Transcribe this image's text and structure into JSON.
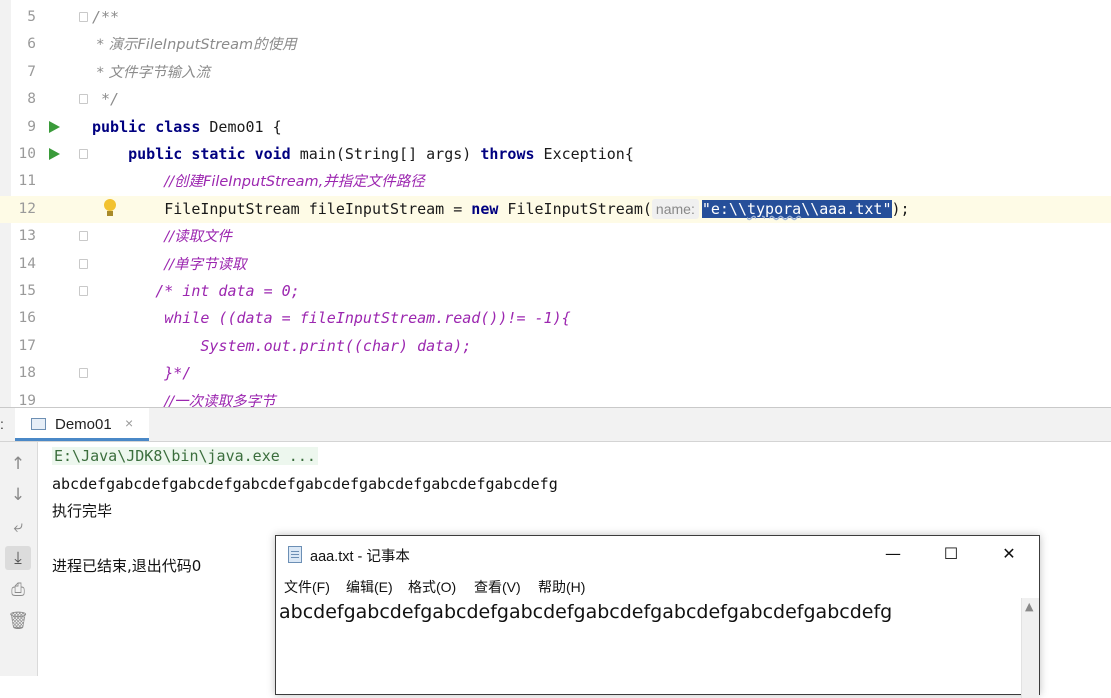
{
  "editor": {
    "lines": [
      {
        "num": "5"
      },
      {
        "num": "6"
      },
      {
        "num": "7"
      },
      {
        "num": "8"
      },
      {
        "num": "9"
      },
      {
        "num": "10"
      },
      {
        "num": "11"
      },
      {
        "num": "12"
      },
      {
        "num": "13"
      },
      {
        "num": "14"
      },
      {
        "num": "15"
      },
      {
        "num": "16"
      },
      {
        "num": "17"
      },
      {
        "num": "18"
      },
      {
        "num": "19"
      }
    ],
    "code": {
      "l5": "/**",
      "l6": " * 演示FileInputStream的使用",
      "l7": " * 文件字节输入流",
      "l8": " */",
      "l9_public": "public",
      "l9_class": "class",
      "l9_name": " Demo01 {",
      "l10_public": "public",
      "l10_static": "static",
      "l10_void": "void",
      "l10_sig": " main(String[] args) ",
      "l10_throws": "throws",
      "l10_exc": " Exception{",
      "l11": "//创建FileInputStream,并指定文件路径",
      "l12_decl": "FileInputStream fileInputStream = ",
      "l12_new": "new",
      "l12_ctor": " FileInputStream(",
      "l12_hint": "name:",
      "l12_str_a": "\"e:\\\\",
      "l12_str_b": "typora",
      "l12_str_c": "\\\\aaa.txt\"",
      "l12_end": ");",
      "l13": "//读取文件",
      "l14": "//单字节读取",
      "l15": "/* int data = 0;",
      "l16": "while ((data = fileInputStream.read())!= -1){",
      "l17": "System.out.print((char) data);",
      "l18": "}*/",
      "l19": "//一次读取多字节"
    }
  },
  "runpanel": {
    "panel_label": ":",
    "tab_label": "Demo01",
    "tab_close": "×",
    "tools": [
      "↑",
      "↓",
      "⤶",
      "⤓",
      "⎙",
      "🗑"
    ],
    "console": {
      "cmd": "E:\\Java\\JDK8\\bin\\java.exe ...",
      "output": "abcdefgabcdefgabcdefgabcdefgabcdefgabcdefgabcdefgabcdefg",
      "done": "执行完毕",
      "exit": "进程已结束,退出代码0"
    }
  },
  "notepad": {
    "title": "aaa.txt - 记事本",
    "min": "—",
    "max": "☐",
    "close": "✕",
    "menus": [
      "文件(F)",
      "编辑(E)",
      "格式(O)",
      "查看(V)",
      "帮助(H)"
    ],
    "content": "abcdefgabcdefgabcdefgabcdefgabcdefgabcdefgabcdefgabcdefg",
    "scroll_up": "▲"
  }
}
